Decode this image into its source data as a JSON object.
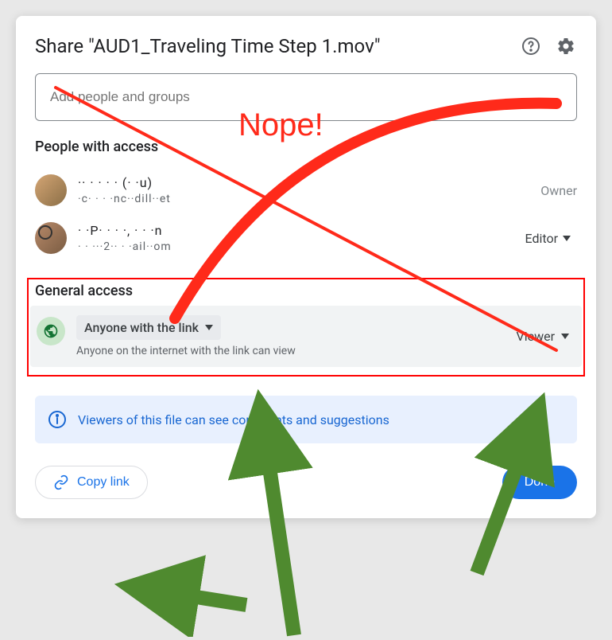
{
  "dialog": {
    "title": "Share \"AUD1_Traveling Time Step 1.mov\"",
    "input_placeholder": "Add people and groups"
  },
  "people_section": {
    "title": "People with access",
    "users": [
      {
        "name": "·· · ·  · ·  (· ·u)",
        "email": "·c·  · ·  ·nc··dill··et",
        "role": "Owner"
      },
      {
        "name": "· ·P·  ·  · ·, ·  ·  ·n",
        "email": "· ·  ···2·· ·  ·ail··om",
        "role": "Editor"
      }
    ]
  },
  "general_access": {
    "title": "General access",
    "scope": "Anyone with the link",
    "description": "Anyone on the internet with the link can view",
    "role": "Viewer"
  },
  "info_banner": "Viewers of this file can see comments and suggestions",
  "footer": {
    "copy_link": "Copy link",
    "done": "Done"
  },
  "annotations": {
    "nope": "Nope!",
    "colors": {
      "red": "#ff2a1a",
      "green": "#4f8a2f"
    }
  }
}
